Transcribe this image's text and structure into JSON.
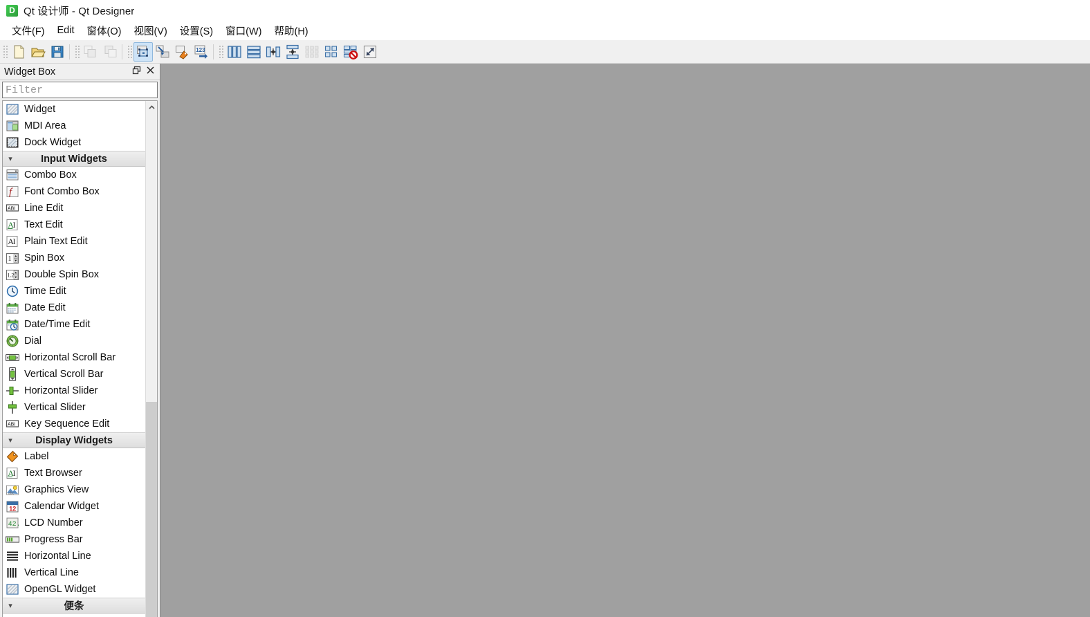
{
  "window": {
    "title": "Qt 设计师 - Qt Designer",
    "app_icon": "qt-designer-icon"
  },
  "menubar": {
    "items": [
      {
        "label": "文件(F)",
        "name": "menu-file"
      },
      {
        "label": "Edit",
        "name": "menu-edit"
      },
      {
        "label": "窗体(O)",
        "name": "menu-form"
      },
      {
        "label": "视图(V)",
        "name": "menu-view"
      },
      {
        "label": "设置(S)",
        "name": "menu-settings"
      },
      {
        "label": "窗口(W)",
        "name": "menu-window"
      },
      {
        "label": "帮助(H)",
        "name": "menu-help"
      }
    ]
  },
  "toolbar": {
    "groups": [
      {
        "name": "file-group",
        "buttons": [
          {
            "icon": "new-file-icon",
            "name": "new-form-button",
            "state": "enabled"
          },
          {
            "icon": "open-folder-icon",
            "name": "open-form-button",
            "state": "enabled"
          },
          {
            "icon": "save-disk-icon",
            "name": "save-form-button",
            "state": "enabled"
          }
        ]
      },
      {
        "name": "edit-group",
        "buttons": [
          {
            "icon": "undo-icon",
            "name": "undo-button",
            "state": "disabled"
          },
          {
            "icon": "redo-icon",
            "name": "redo-button",
            "state": "disabled"
          }
        ]
      },
      {
        "name": "mode-group",
        "buttons": [
          {
            "icon": "edit-widgets-icon",
            "name": "edit-widgets-button",
            "state": "checked"
          },
          {
            "icon": "edit-signals-slots-icon",
            "name": "edit-signals-slots-button",
            "state": "enabled"
          },
          {
            "icon": "edit-buddies-icon",
            "name": "edit-buddies-button",
            "state": "enabled"
          },
          {
            "icon": "edit-tab-order-icon",
            "name": "edit-tab-order-button",
            "state": "enabled"
          }
        ]
      },
      {
        "name": "layout-group",
        "buttons": [
          {
            "icon": "layout-horizontal-icon",
            "name": "layout-horizontally-button",
            "state": "enabled"
          },
          {
            "icon": "layout-vertical-icon",
            "name": "layout-vertically-button",
            "state": "enabled"
          },
          {
            "icon": "layout-splitter-horizontal-icon",
            "name": "layout-splitter-horizontal-button",
            "state": "enabled"
          },
          {
            "icon": "layout-splitter-vertical-icon",
            "name": "layout-splitter-vertical-button",
            "state": "enabled"
          },
          {
            "icon": "layout-grid-icon",
            "name": "layout-grid-button",
            "state": "disabled"
          },
          {
            "icon": "layout-form-icon",
            "name": "layout-form-button",
            "state": "enabled"
          },
          {
            "icon": "break-layout-icon",
            "name": "break-layout-button",
            "state": "enabled"
          },
          {
            "icon": "adjust-size-icon",
            "name": "adjust-size-button",
            "state": "enabled"
          }
        ]
      }
    ]
  },
  "widget_box": {
    "title": "Widget Box",
    "float_button": "float-icon",
    "close_button": "close-icon",
    "filter": {
      "value": "",
      "placeholder": "Filter"
    },
    "scrollbar": {
      "up_arrow": "chevron-up-icon"
    },
    "sections": [
      {
        "name": "ungrouped-top",
        "is_category": false,
        "items": [
          {
            "label": "Widget",
            "icon": "widget-icon"
          },
          {
            "label": "MDI Area",
            "icon": "mdi-area-icon"
          },
          {
            "label": "Dock Widget",
            "icon": "dock-widget-icon"
          }
        ]
      },
      {
        "name": "input-widgets",
        "is_category": true,
        "label": "Input Widgets",
        "expanded": true,
        "items": [
          {
            "label": "Combo Box",
            "icon": "combo-box-icon"
          },
          {
            "label": "Font Combo Box",
            "icon": "font-combo-box-icon"
          },
          {
            "label": "Line Edit",
            "icon": "line-edit-icon"
          },
          {
            "label": "Text Edit",
            "icon": "text-edit-icon"
          },
          {
            "label": "Plain Text Edit",
            "icon": "plain-text-edit-icon"
          },
          {
            "label": "Spin Box",
            "icon": "spin-box-icon"
          },
          {
            "label": "Double Spin Box",
            "icon": "double-spin-box-icon"
          },
          {
            "label": "Time Edit",
            "icon": "time-edit-icon"
          },
          {
            "label": "Date Edit",
            "icon": "date-edit-icon"
          },
          {
            "label": "Date/Time Edit",
            "icon": "date-time-edit-icon"
          },
          {
            "label": "Dial",
            "icon": "dial-icon"
          },
          {
            "label": "Horizontal Scroll Bar",
            "icon": "horizontal-scroll-bar-icon"
          },
          {
            "label": "Vertical Scroll Bar",
            "icon": "vertical-scroll-bar-icon"
          },
          {
            "label": "Horizontal Slider",
            "icon": "horizontal-slider-icon"
          },
          {
            "label": "Vertical Slider",
            "icon": "vertical-slider-icon"
          },
          {
            "label": "Key Sequence Edit",
            "icon": "key-sequence-edit-icon"
          }
        ]
      },
      {
        "name": "display-widgets",
        "is_category": true,
        "label": "Display Widgets",
        "expanded": true,
        "items": [
          {
            "label": "Label",
            "icon": "label-icon"
          },
          {
            "label": "Text Browser",
            "icon": "text-browser-icon"
          },
          {
            "label": "Graphics View",
            "icon": "graphics-view-icon"
          },
          {
            "label": "Calendar Widget",
            "icon": "calendar-widget-icon"
          },
          {
            "label": "LCD Number",
            "icon": "lcd-number-icon"
          },
          {
            "label": "Progress Bar",
            "icon": "progress-bar-icon"
          },
          {
            "label": "Horizontal Line",
            "icon": "horizontal-line-icon"
          },
          {
            "label": "Vertical Line",
            "icon": "vertical-line-icon"
          },
          {
            "label": "OpenGL Widget",
            "icon": "opengl-widget-icon"
          }
        ]
      },
      {
        "name": "scratchpad",
        "is_category": true,
        "label": "便条",
        "expanded": true,
        "items": []
      }
    ]
  },
  "canvas": {
    "background_color": "#a0a0a0"
  },
  "colors": {
    "chrome": "#f0f0f0",
    "canvas": "#a0a0a0",
    "accent_checked": "#cde3f7",
    "text": "#111111"
  }
}
